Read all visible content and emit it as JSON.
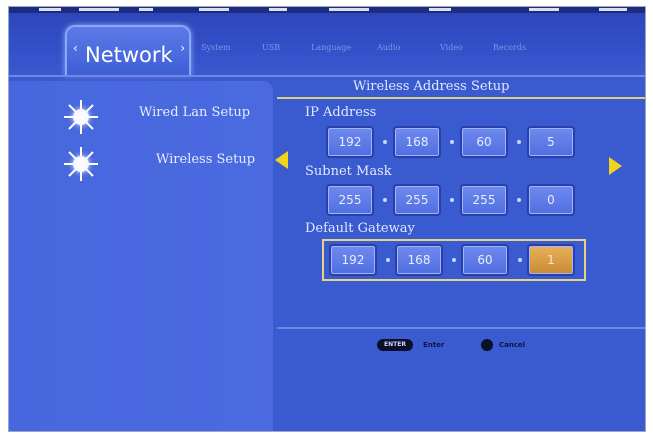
{
  "header": {
    "active_tab": "Network",
    "menu": [
      "System",
      "USB",
      "Language",
      "Audio",
      "Video",
      "Records"
    ]
  },
  "sidebar": {
    "items": [
      {
        "label": "Wired Lan Setup",
        "icon": "sun-icon"
      },
      {
        "label": "Wireless Setup",
        "icon": "sun-icon"
      }
    ]
  },
  "panel": {
    "title": "Wireless Address Setup",
    "fields": [
      {
        "label": "IP Address",
        "octets": [
          "192",
          "168",
          "60",
          "5"
        ]
      },
      {
        "label": "Subnet Mask",
        "octets": [
          "255",
          "255",
          "255",
          "0"
        ]
      },
      {
        "label": "Default Gateway",
        "octets": [
          "192",
          "168",
          "60",
          "1"
        ],
        "highlight_index": 3
      }
    ]
  },
  "footer": {
    "enter_key": "ENTER",
    "enter_label": "Enter",
    "cancel_label": "Cancel"
  },
  "colors": {
    "background": "#3a5ad0",
    "accent": "#f3d21a",
    "highlight": "#d9a04a"
  }
}
